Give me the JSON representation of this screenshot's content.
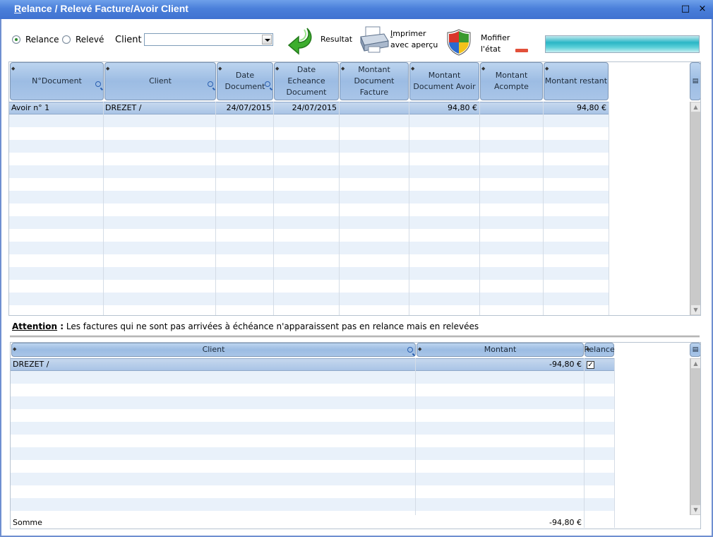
{
  "window": {
    "title_prefix": "R",
    "title_rest": "elance / Relevé  Facture/Avoir Client",
    "maximize_glyph": "□",
    "close_glyph": "×"
  },
  "toolbar": {
    "mode_relance": "Relance",
    "mode_releve": "Relevé",
    "selected_mode": "Relance",
    "client_label": "Client",
    "client_value": "",
    "resultat_label": "Resultat",
    "imprimer_line1": "Imprimer",
    "imprimer_line2": "avec aperçu",
    "modifier_line1": "Mofifier",
    "modifier_line2": "l'état"
  },
  "documents": {
    "columns": [
      "N°Document",
      "Client",
      "Date Document",
      "Date Echeance Document",
      "Montant Document Facture",
      "Montant Document Avoir",
      "Montant Acompte",
      "Montant restant"
    ],
    "rows": [
      {
        "numero": "Avoir  n° 1",
        "client": "DREZET /",
        "date": "24/07/2015",
        "echeance": "24/07/2015",
        "facture": "",
        "avoir": "94,80 €",
        "acompte": "",
        "restant": "94,80 €"
      }
    ]
  },
  "notice": {
    "heading": "Attention",
    "colon": " :",
    "text": " Les factures qui ne sont pas arrivées à échéance n'apparaissent pas en relance mais en relevées"
  },
  "summary": {
    "columns": [
      "Client",
      "Montant",
      "Relance"
    ],
    "rows": [
      {
        "client": "DREZET /",
        "montant": "-94,80 €",
        "relance": true
      }
    ],
    "footer_label": "Somme",
    "footer_total": "-94,80 €"
  },
  "colors": {
    "title_bar": "#4a7fda",
    "header": "#9cbce3",
    "selected_row": "#a9c4e6",
    "alt_row": "#e9f1fa"
  }
}
